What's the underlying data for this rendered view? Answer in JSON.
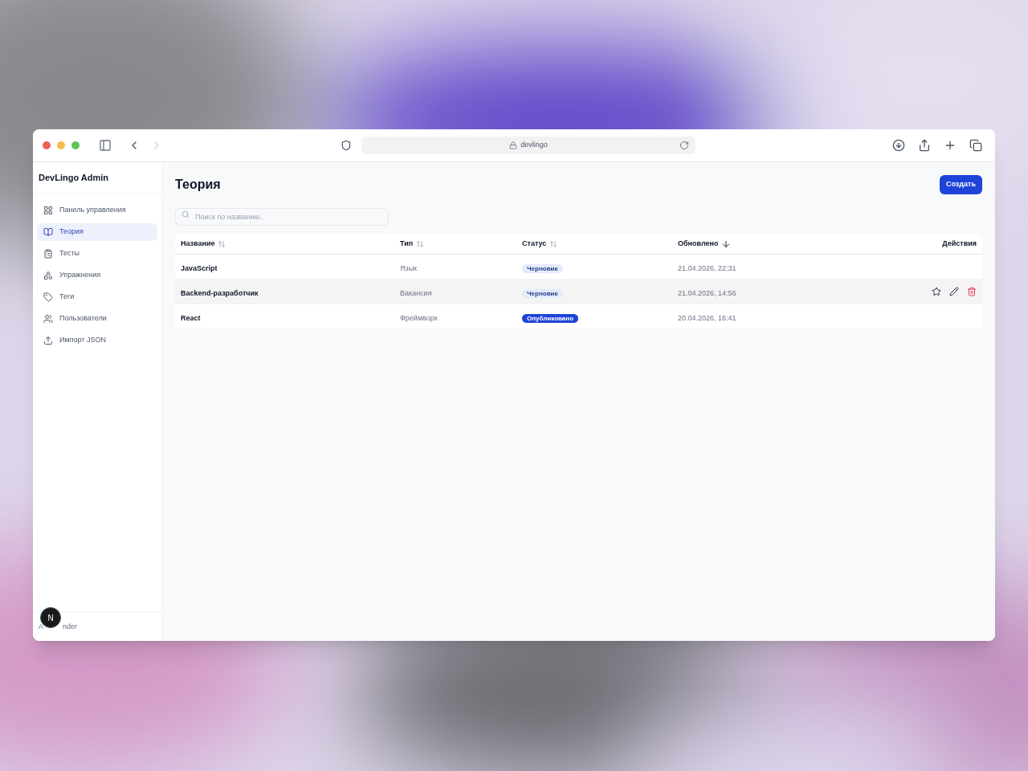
{
  "browser": {
    "address": "devlingo"
  },
  "sidebar": {
    "title": "DevLingo Admin",
    "items": [
      {
        "label": "Панель управления",
        "selected": false
      },
      {
        "label": "Теория",
        "selected": true
      },
      {
        "label": "Тесты",
        "selected": false
      },
      {
        "label": "Упражнения",
        "selected": false
      },
      {
        "label": "Теги",
        "selected": false
      },
      {
        "label": "Пользователи",
        "selected": false
      },
      {
        "label": "Импорт JSON",
        "selected": false
      }
    ],
    "user_visible_parts": [
      "A",
      "nder"
    ],
    "badge": "N"
  },
  "page": {
    "title": "Теория",
    "create_button": "Создать",
    "search": {
      "placeholder": "Поиск по названию.."
    }
  },
  "table": {
    "columns": [
      {
        "label": "Название",
        "kind": "sortable"
      },
      {
        "label": "Тип",
        "kind": "sortable"
      },
      {
        "label": "Статус",
        "kind": "sortable"
      },
      {
        "label": "Обновлено",
        "kind": "sorted"
      },
      {
        "label": "Действия",
        "kind": "plain"
      }
    ],
    "rows": [
      {
        "name": "JavaScript",
        "type": "Язык",
        "status": {
          "label": "Черновик",
          "kind": "draft"
        },
        "updated": "21.04.2026, 22:31",
        "hovered": false
      },
      {
        "name": "Backend-разработчик",
        "type": "Вакансия",
        "status": {
          "label": "Черновик",
          "kind": "draft"
        },
        "updated": "21.04.2026, 14:56",
        "hovered": true
      },
      {
        "name": "React",
        "type": "Фреймворк",
        "status": {
          "label": "Опубликовано",
          "kind": "published"
        },
        "updated": "20.04.2026, 16:41",
        "hovered": false
      }
    ]
  }
}
